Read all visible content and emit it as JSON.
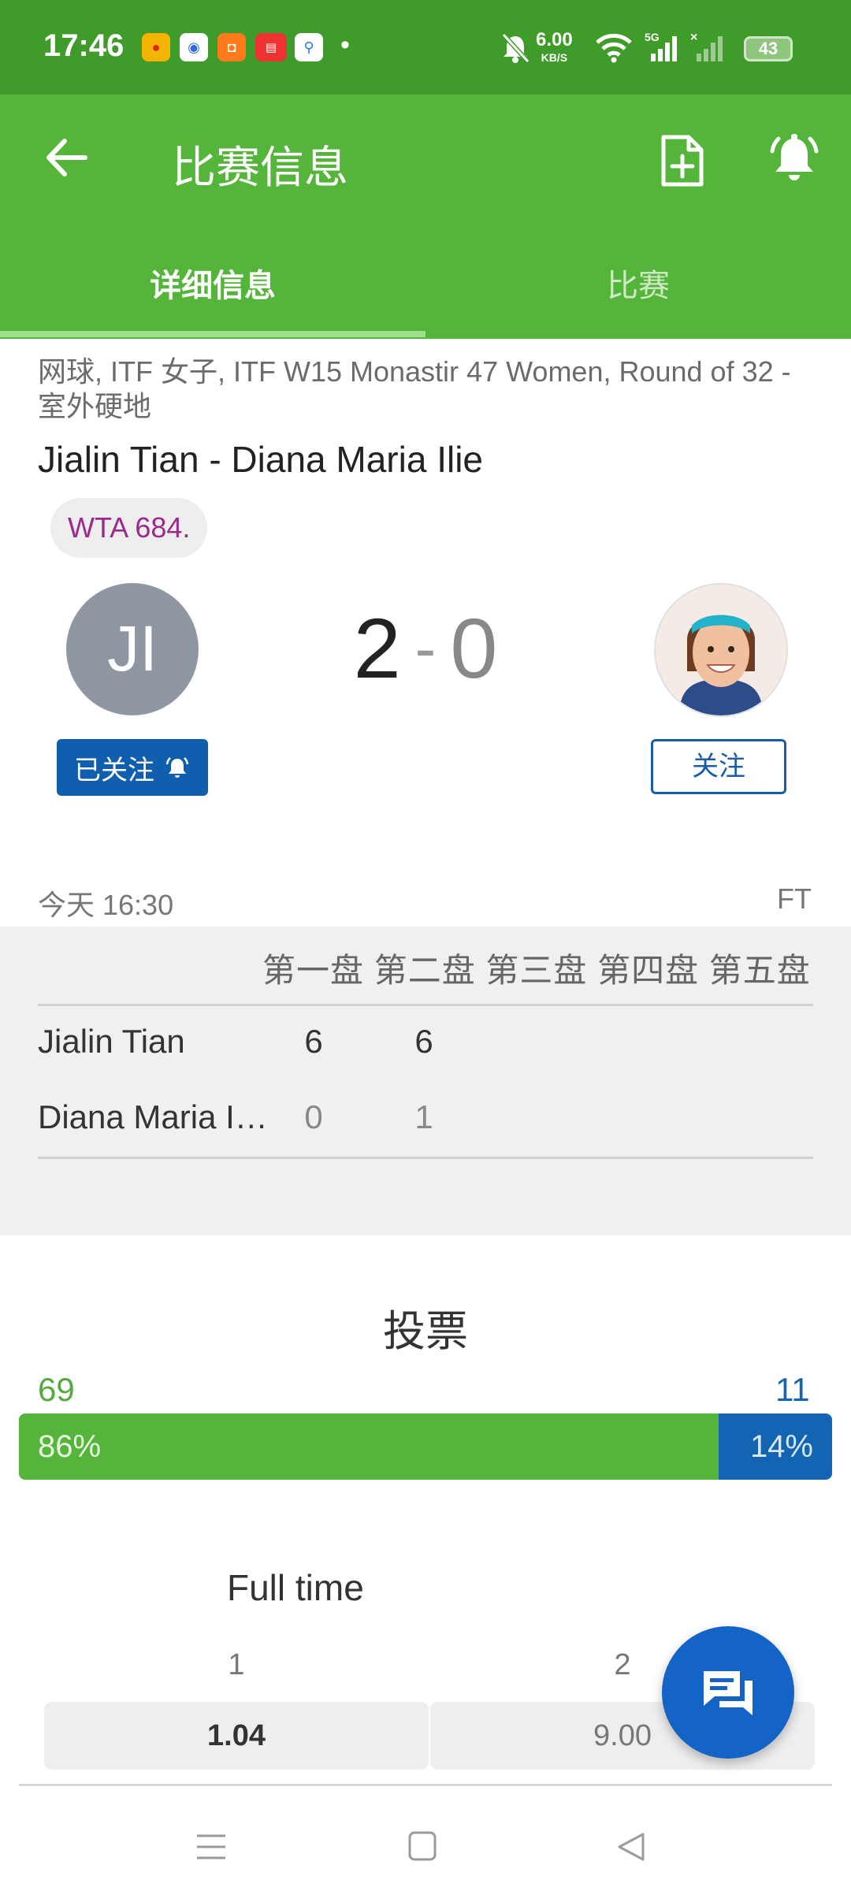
{
  "status_bar": {
    "time": "17:46",
    "net_speed": "6.00",
    "net_unit": "KB/S",
    "battery": "43",
    "colors": {
      "background": "#3f9b2a"
    }
  },
  "app_bar": {
    "title": "比赛信息",
    "back_icon": "arrow-left-icon",
    "actions": [
      "add-document-icon",
      "bell-icon"
    ],
    "colors": {
      "background": "#55b43a"
    }
  },
  "tabs": [
    {
      "label": "详细信息",
      "active": true
    },
    {
      "label": "比赛",
      "active": false
    }
  ],
  "match": {
    "competition": "网球, ITF 女子, ITF W15 Monastir 47 Women, Round of 32 - 室外硬地",
    "title": "Jialin Tian - Diana Maria Ilie",
    "ranking_badge": "WTA 684.",
    "home_initials": "JI",
    "score_home": "2",
    "score_separator": "-",
    "score_away": "0",
    "followed_label": "已关注",
    "follow_label": "关注",
    "time": "今天 16:30",
    "status": "FT"
  },
  "sets": {
    "headers": [
      "第一盘",
      "第二盘",
      "第三盘",
      "第四盘",
      "第五盘"
    ],
    "rows": [
      {
        "player": "Jialin Tian",
        "scores": [
          "6",
          "6"
        ]
      },
      {
        "player": "Diana Maria I…",
        "scores": [
          "0",
          "1"
        ]
      }
    ]
  },
  "vote": {
    "title": "投票",
    "home_count": "69",
    "away_count": "11",
    "home_percent_label": "86%",
    "away_percent_label": "14%",
    "home_share": 0.86,
    "colors": {
      "home": "#55b43a",
      "away": "#1464b4"
    }
  },
  "odds": {
    "title": "Full time",
    "col_home": "1",
    "col_away": "2",
    "home_value": "1.04",
    "away_value": "9.00"
  },
  "fab": {
    "icon": "chat-icon"
  },
  "nav_bar": {
    "icons": [
      "menu-icon",
      "home-square-icon",
      "back-triangle-icon"
    ]
  }
}
